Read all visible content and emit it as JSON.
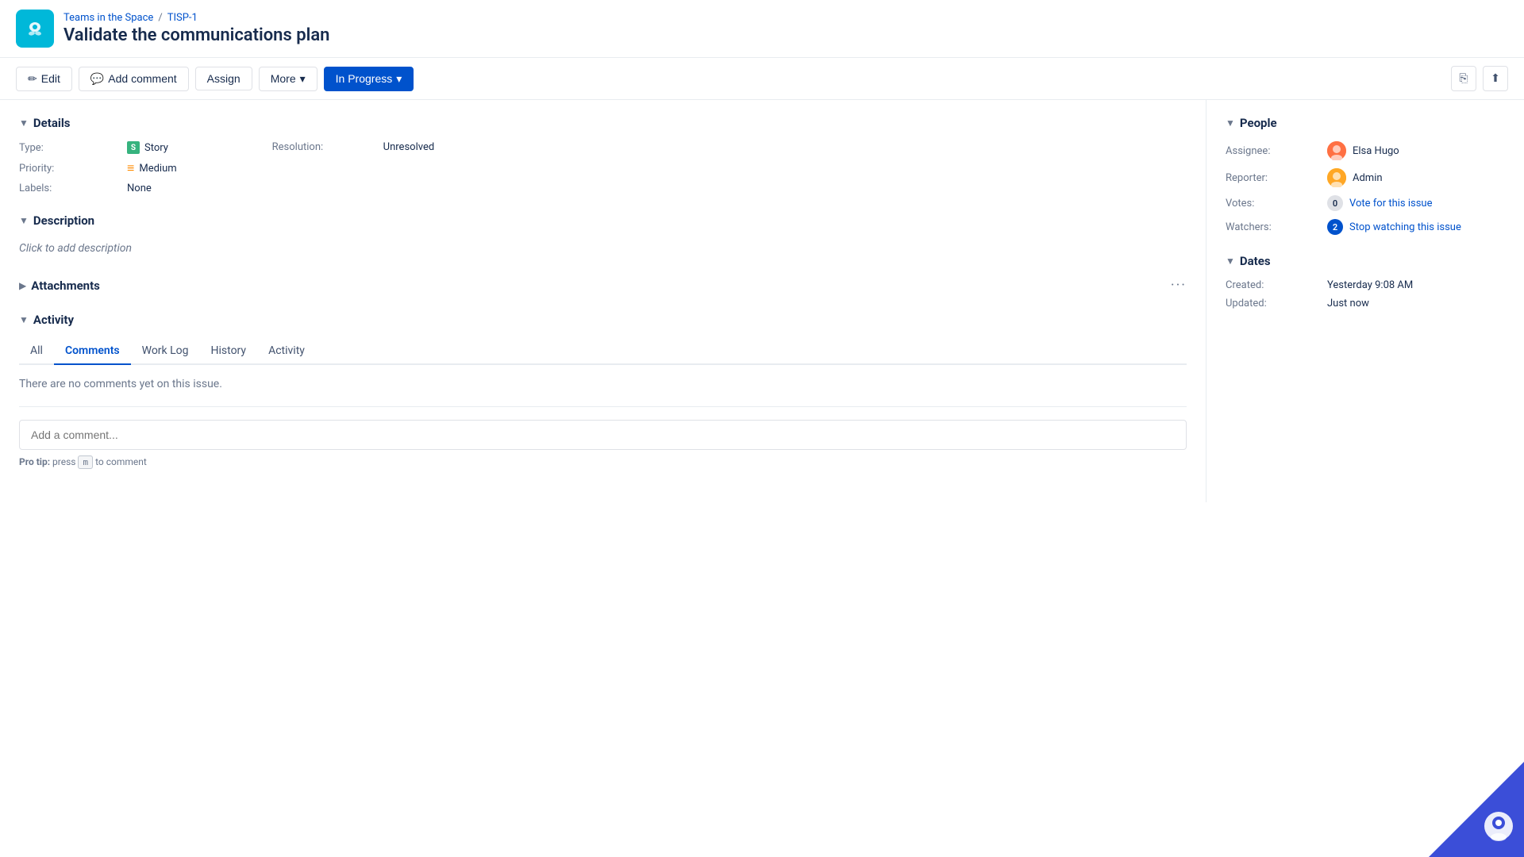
{
  "app": {
    "logo_alt": "Jira-like app logo"
  },
  "breadcrumb": {
    "project": "Teams in the Space",
    "separator": "/",
    "issue_id": "TISP-1"
  },
  "page": {
    "title": "Validate the communications plan"
  },
  "toolbar": {
    "edit_label": "Edit",
    "add_comment_label": "Add comment",
    "assign_label": "Assign",
    "more_label": "More",
    "status_label": "In Progress",
    "chevron_down": "▾"
  },
  "details": {
    "section_title": "Details",
    "type_label": "Type:",
    "type_value": "Story",
    "priority_label": "Priority:",
    "priority_value": "Medium",
    "labels_label": "Labels:",
    "labels_value": "None",
    "resolution_label": "Resolution:",
    "resolution_value": "Unresolved"
  },
  "description": {
    "section_title": "Description",
    "placeholder": "Click to add description"
  },
  "attachments": {
    "section_title": "Attachments",
    "more_dots": "···"
  },
  "activity": {
    "section_title": "Activity",
    "tabs": [
      {
        "id": "all",
        "label": "All"
      },
      {
        "id": "comments",
        "label": "Comments",
        "active": true
      },
      {
        "id": "worklog",
        "label": "Work Log"
      },
      {
        "id": "history",
        "label": "History"
      },
      {
        "id": "activity",
        "label": "Activity"
      }
    ],
    "no_comments_text": "There are no comments yet on this issue.",
    "comment_placeholder": "Add a comment...",
    "pro_tip_prefix": "Pro tip:",
    "pro_tip_key": "m",
    "pro_tip_suffix": "to comment"
  },
  "people": {
    "section_title": "People",
    "assignee_label": "Assignee:",
    "assignee_name": "Elsa Hugo",
    "reporter_label": "Reporter:",
    "reporter_name": "Admin",
    "votes_label": "Votes:",
    "votes_count": "0",
    "votes_link": "Vote for this issue",
    "watchers_label": "Watchers:",
    "watchers_count": "2",
    "watchers_link": "Stop watching this issue"
  },
  "dates": {
    "section_title": "Dates",
    "created_label": "Created:",
    "created_value": "Yesterday 9:08 AM",
    "updated_label": "Updated:",
    "updated_value": "Just now"
  },
  "icons": {
    "edit": "✏",
    "comment": "💬",
    "share": "⎘",
    "export": "⬆",
    "chevron_down": "▾",
    "chevron_right": "▶",
    "chevron_down_white": "▾"
  }
}
